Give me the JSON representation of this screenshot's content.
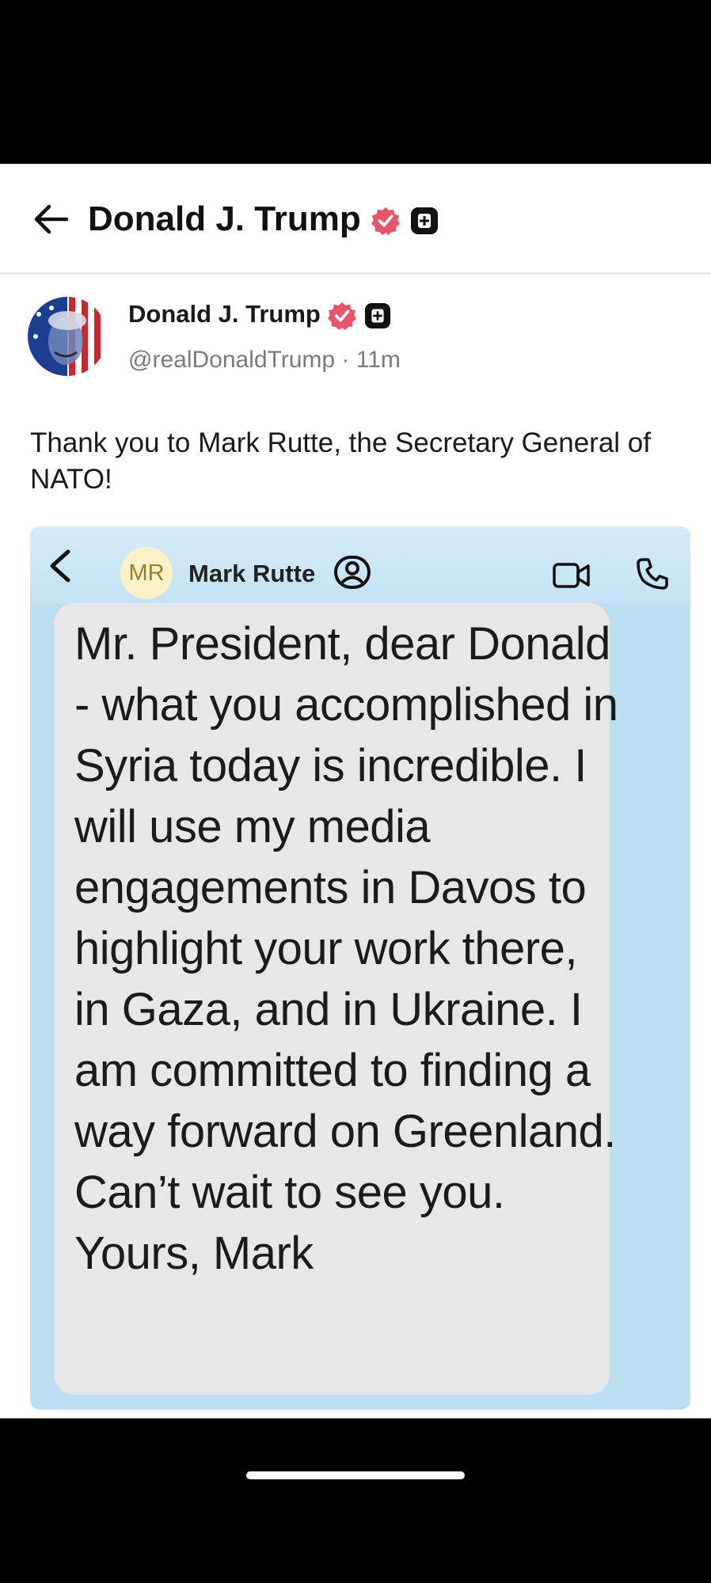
{
  "header": {
    "title": "Donald J. Trump",
    "back_icon": "arrow-left-icon",
    "badges": [
      "verified-icon",
      "plus-badge-icon"
    ]
  },
  "post": {
    "author_name": "Donald J. Trump",
    "handle_time": "@realDonaldTrump · 11m",
    "text": "Thank you to Mark Rutte, the Secretary General of NATO!"
  },
  "embed": {
    "contact_initials": "MR",
    "contact_name": "Mark Rutte",
    "icons": [
      "chevron-left-icon",
      "contact-card-icon",
      "video-call-icon",
      "phone-icon"
    ],
    "message": "Mr. President, dear Donald - what you accomplished in Syria today is incredible. I will use my media engagements in Davos to highlight your work there, in Gaza, and in Ukraine. I am committed to finding a way forward on Greenland. Can’t wait to see you. Yours, Mark"
  },
  "colors": {
    "verified": "#e8546c",
    "embed_background": "#bcdff1",
    "bubble": "#e7e7e7"
  }
}
